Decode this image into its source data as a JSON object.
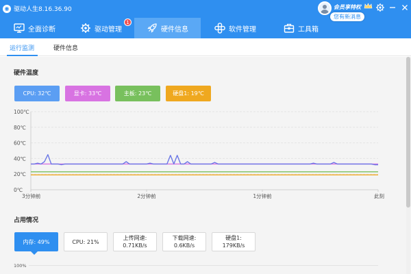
{
  "app": {
    "title": "驱动人生8.16.36.90",
    "logo_icon": "driver-app-logo-icon"
  },
  "account": {
    "vip_label": "会员享特权",
    "message_badge": "您有新消息",
    "avatar_icon": "user-avatar-icon",
    "crown_icon": "crown-icon"
  },
  "window_controls": {
    "settings_icon": "gear-icon",
    "minimize_icon": "minimize-icon",
    "close_icon": "close-icon"
  },
  "nav": {
    "items": [
      {
        "label": "全面诊断",
        "icon": "monitor-icon"
      },
      {
        "label": "驱动管理",
        "icon": "gear-icon",
        "badge": "1"
      },
      {
        "label": "硬件信息",
        "icon": "rocket-icon",
        "active": true
      },
      {
        "label": "软件管理",
        "icon": "apps-icon"
      },
      {
        "label": "工具箱",
        "icon": "toolbox-icon"
      }
    ]
  },
  "subtabs": [
    {
      "label": "运行监测",
      "active": true
    },
    {
      "label": "硬件信息",
      "active": false
    }
  ],
  "temperature": {
    "title": "硬件温度",
    "chips": [
      {
        "label": "CPU: 32℃",
        "color": "#5b9ef3"
      },
      {
        "label": "显卡: 33℃",
        "color": "#d873e2"
      },
      {
        "label": "主板: 23℃",
        "color": "#78c05d"
      },
      {
        "label": "硬盘1: 19℃",
        "color": "#efa81f"
      }
    ]
  },
  "chart_data": {
    "type": "line",
    "title": "",
    "xlabel": "",
    "ylabel": "",
    "ylim": [
      0,
      100
    ],
    "y_ticks": [
      "0℃",
      "20℃",
      "40℃",
      "60℃",
      "80℃",
      "100℃"
    ],
    "x_ticks": [
      "3分钟前",
      "2分钟前",
      "1分钟前",
      "此刻"
    ],
    "grid": true,
    "series": [
      {
        "name": "CPU",
        "color": "#6b78e6",
        "values": [
          33,
          33,
          34,
          33,
          36,
          33,
          33,
          33,
          33,
          32,
          33,
          33,
          33,
          33,
          33,
          33,
          33,
          33,
          33,
          33,
          33,
          33,
          33,
          33,
          33,
          33,
          33,
          33,
          33,
          33,
          33,
          33,
          33,
          33,
          33,
          34,
          33,
          33,
          33,
          33,
          33,
          33,
          33,
          33,
          33,
          33,
          33,
          33,
          33,
          33,
          33,
          33,
          33,
          33,
          33,
          33,
          33,
          33,
          33,
          33,
          33,
          33,
          33,
          33,
          33,
          33,
          33,
          33,
          33,
          33,
          33,
          33,
          33,
          33,
          33,
          33,
          33,
          33,
          33,
          33,
          33,
          33,
          33,
          34,
          33,
          33,
          33,
          33,
          33,
          33,
          33,
          33,
          33,
          33,
          33,
          33,
          33,
          33,
          33,
          33,
          33,
          32,
          32
        ]
      },
      {
        "name": "显卡",
        "color": "#d873e2",
        "values": [
          33,
          33,
          33,
          33,
          33,
          33,
          33,
          33,
          33,
          33,
          33,
          33,
          33,
          33,
          33,
          33,
          33,
          33,
          33,
          33,
          33,
          33,
          33,
          33,
          33,
          33,
          33,
          33,
          33,
          33,
          33,
          33,
          33,
          33,
          33,
          33,
          33,
          33,
          33,
          33,
          33,
          33,
          33,
          33,
          33,
          33,
          33,
          33,
          33,
          33,
          33,
          33,
          33,
          33,
          33,
          33,
          33,
          33,
          33,
          33,
          33,
          33,
          33,
          33,
          33,
          33,
          33,
          33,
          33,
          33,
          33,
          33,
          33,
          33,
          33,
          33,
          33,
          33,
          33,
          33,
          33,
          33,
          33,
          33,
          33,
          33,
          33,
          33,
          33,
          33,
          33,
          33,
          33,
          33,
          33,
          33,
          33,
          33,
          33,
          33,
          33,
          33,
          33
        ]
      },
      {
        "name": "主板",
        "color": "#78c05d",
        "values": [
          23,
          23,
          23,
          23,
          23,
          23,
          23,
          23,
          23,
          23,
          23,
          23,
          23,
          23,
          23,
          23,
          23,
          23,
          23,
          23,
          23,
          23,
          23,
          23,
          23,
          23,
          23,
          23,
          23,
          23,
          23,
          23,
          23,
          23,
          23,
          23,
          23,
          23,
          23,
          23,
          23,
          23,
          23,
          23,
          23,
          23,
          23,
          23,
          23,
          23,
          23,
          23,
          23,
          23,
          23,
          23,
          23,
          23,
          23,
          23,
          23,
          23,
          23,
          23,
          23,
          23,
          23,
          23,
          23,
          23,
          23,
          23,
          23,
          23,
          23,
          23,
          23,
          23,
          23,
          23,
          23,
          23,
          23,
          23,
          23,
          23,
          23,
          23,
          23,
          23,
          23,
          23,
          23,
          23,
          23,
          23,
          23,
          23,
          23,
          23,
          23,
          23,
          23
        ]
      },
      {
        "name": "硬盘1",
        "color": "#efa81f",
        "values": [
          19,
          19,
          19,
          19,
          19,
          19,
          19,
          19,
          19,
          19,
          19,
          19,
          19,
          19,
          19,
          19,
          19,
          19,
          19,
          19,
          19,
          19,
          19,
          19,
          19,
          19,
          19,
          19,
          19,
          19,
          19,
          19,
          19,
          19,
          19,
          19,
          19,
          19,
          19,
          19,
          19,
          19,
          19,
          19,
          19,
          19,
          19,
          19,
          19,
          19,
          19,
          19,
          19,
          19,
          19,
          19,
          19,
          19,
          19,
          19,
          19,
          19,
          19,
          19,
          19,
          19,
          19,
          19,
          19,
          19,
          19,
          19,
          19,
          19,
          19,
          19,
          19,
          19,
          19,
          19,
          19,
          19,
          19,
          19,
          19,
          19,
          19,
          19,
          19,
          19,
          19,
          19,
          19,
          19,
          19,
          19,
          19,
          19,
          19,
          19,
          19,
          19,
          19
        ]
      }
    ],
    "spikes": [
      {
        "series": "CPU",
        "index": 5,
        "value": 45
      },
      {
        "series": "CPU",
        "index": 28,
        "value": 36
      },
      {
        "series": "CPU",
        "index": 41,
        "value": 44
      },
      {
        "series": "CPU",
        "index": 43,
        "value": 44
      },
      {
        "series": "CPU",
        "index": 46,
        "value": 36
      },
      {
        "series": "CPU",
        "index": 54,
        "value": 35
      },
      {
        "series": "CPU",
        "index": 89,
        "value": 35
      }
    ]
  },
  "usage": {
    "title": "占用情况",
    "boxes": [
      {
        "line1": "内存: 49%",
        "line2": "",
        "active": true
      },
      {
        "line1": "CPU: 21%",
        "line2": "",
        "active": false
      },
      {
        "line1": "上传网速:",
        "line2": "0.71KB/s",
        "active": false
      },
      {
        "line1": "下载网速:",
        "line2": "0.6KB/s",
        "active": false
      },
      {
        "line1": "硬盘1:",
        "line2": "179KB/s",
        "active": false
      }
    ],
    "axis_top_label": "100%"
  }
}
